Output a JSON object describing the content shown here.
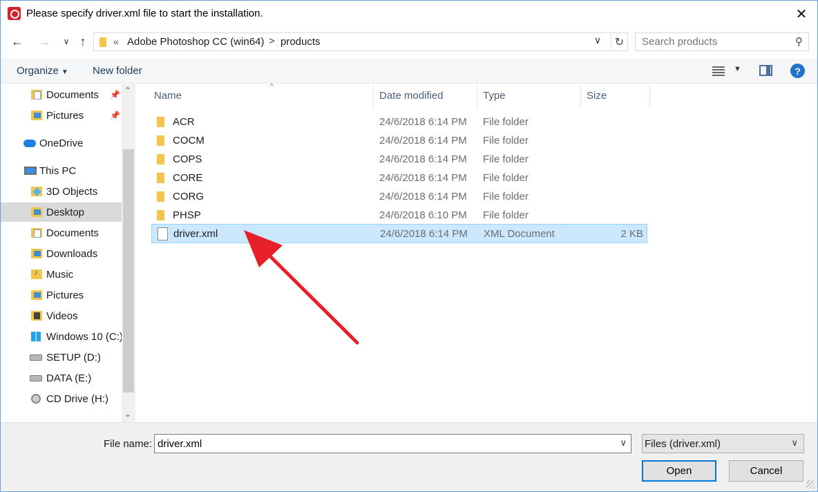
{
  "window": {
    "title": "Please specify driver.xml file to start the installation.",
    "close_glyph": "✕"
  },
  "nav": {
    "back": "←",
    "forward": "→",
    "recent": "∨",
    "up": "↑",
    "address": {
      "overflow": "«",
      "crumbs": [
        "Adobe Photoshop CC (win64)",
        "products"
      ],
      "separator": ">",
      "dropdown": "∨",
      "refresh": "↻"
    },
    "search": {
      "placeholder": "Search products",
      "icon": "search-icon"
    }
  },
  "toolbar": {
    "organize": "Organize",
    "new_folder": "New folder",
    "help": "?"
  },
  "sidebar": {
    "items": [
      {
        "label": "Documents",
        "icon": "documents-folder-icon",
        "pinned": true
      },
      {
        "label": "Pictures",
        "icon": "pictures-folder-icon",
        "pinned": true
      },
      {
        "label": "OneDrive",
        "icon": "onedrive-cloud-icon"
      },
      {
        "label": "This PC",
        "icon": "this-pc-icon"
      },
      {
        "label": "3D Objects",
        "icon": "3d-objects-folder-icon"
      },
      {
        "label": "Desktop",
        "icon": "desktop-folder-icon",
        "selected": true
      },
      {
        "label": "Documents",
        "icon": "documents-folder-icon"
      },
      {
        "label": "Downloads",
        "icon": "downloads-folder-icon"
      },
      {
        "label": "Music",
        "icon": "music-folder-icon"
      },
      {
        "label": "Pictures",
        "icon": "pictures-folder-icon"
      },
      {
        "label": "Videos",
        "icon": "videos-folder-icon"
      },
      {
        "label": "Windows 10 (C:)",
        "icon": "windows-drive-icon"
      },
      {
        "label": "SETUP (D:)",
        "icon": "drive-icon"
      },
      {
        "label": "DATA (E:)",
        "icon": "drive-icon"
      },
      {
        "label": "CD Drive (H:)",
        "icon": "cd-drive-icon"
      }
    ]
  },
  "file_list": {
    "columns": [
      "Name",
      "Date modified",
      "Type",
      "Size"
    ],
    "rows": [
      {
        "name": "ACR",
        "date": "24/6/2018 6:14 PM",
        "type": "File folder",
        "size": ""
      },
      {
        "name": "COCM",
        "date": "24/6/2018 6:14 PM",
        "type": "File folder",
        "size": ""
      },
      {
        "name": "COPS",
        "date": "24/6/2018 6:14 PM",
        "type": "File folder",
        "size": ""
      },
      {
        "name": "CORE",
        "date": "24/6/2018 6:14 PM",
        "type": "File folder",
        "size": ""
      },
      {
        "name": "CORG",
        "date": "24/6/2018 6:14 PM",
        "type": "File folder",
        "size": ""
      },
      {
        "name": "PHSP",
        "date": "24/6/2018 6:10 PM",
        "type": "File folder",
        "size": ""
      },
      {
        "name": "driver.xml",
        "date": "24/6/2018 6:14 PM",
        "type": "XML Document",
        "size": "2 KB",
        "selected": true
      }
    ]
  },
  "footer": {
    "file_name_label": "File name:",
    "file_name_value": "driver.xml",
    "filter_value": "Files (driver.xml)",
    "open_label": "Open",
    "cancel_label": "Cancel"
  },
  "colors": {
    "selection": "#cce8ff",
    "annotation_arrow": "#e8202a",
    "accent": "#0078d7"
  }
}
